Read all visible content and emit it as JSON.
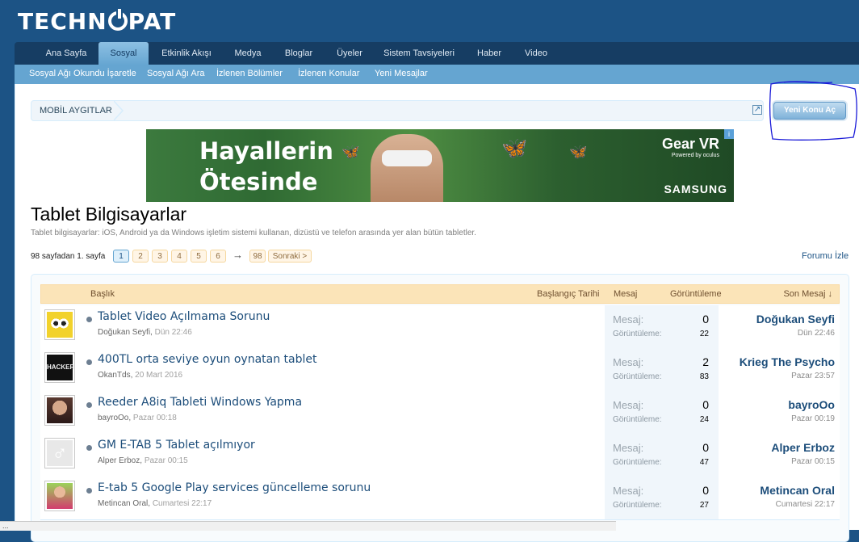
{
  "logo": {
    "text_pre": "TECHN",
    "text_post": "PAT"
  },
  "nav": {
    "tabs": [
      "Ana Sayfa",
      "Sosyal",
      "Etkinlik Akışı",
      "Medya",
      "Bloglar",
      "Üyeler",
      "Sistem Tavsiyeleri",
      "Haber",
      "Video"
    ],
    "active": "Sosyal"
  },
  "subnav": [
    "Sosyal Ağı Okundu İşaretle",
    "Sosyal Ağı Ara",
    "İzlenen Bölümler",
    "İzlenen Konular",
    "Yeni Mesajlar"
  ],
  "breadcrumb": "MOBİL AYGITLAR",
  "new_thread_button": "Yeni Konu Aç",
  "banner": {
    "headline_1": "Hayallerin",
    "headline_2": "Ötesinde",
    "brand": "Gear VR",
    "powered": "Powered by oculus",
    "maker": "SAMSUNG",
    "info": "i"
  },
  "forum": {
    "title": "Tablet Bilgisayarlar",
    "description": "Tablet bilgisayarlar: iOS, Android ya da Windows işletim sistemi kullanan, dizüstü ve telefon arasında yer alan bütün tabletler.",
    "follow": "Forumu İzle"
  },
  "pager": {
    "label": "98 sayfadan 1. sayfa",
    "pages": [
      "1",
      "2",
      "3",
      "4",
      "5",
      "6"
    ],
    "arrow": "→",
    "last": "98",
    "next": "Sonraki >"
  },
  "columns": {
    "title": "Başlık",
    "start_date": "Başlangıç Tarihi",
    "replies": "Mesaj",
    "views": "Görüntüleme",
    "last": "Son Mesaj ↓"
  },
  "threads": [
    {
      "title": "Tablet Video Açılmama Sorunu",
      "author": "Doğukan Seyfi",
      "date": "Dün 22:46",
      "replies_label": "Mesaj:",
      "replies": "0",
      "views_label": "Görüntüleme:",
      "views": "22",
      "last_user": "Doğukan Seyfi",
      "last_date": "Dün 22:46"
    },
    {
      "title": "400TL orta seviye oyun oynatan tablet",
      "author": "OkanTds",
      "date": "20 Mart 2016",
      "replies_label": "Mesaj:",
      "replies": "2",
      "views_label": "Görüntüleme:",
      "views": "83",
      "last_user": "Krieg The Psycho",
      "last_date": "Pazar 23:57"
    },
    {
      "title": "Reeder A8iq Tableti Windows Yapma",
      "author": "bayroOo",
      "date": "Pazar 00:18",
      "replies_label": "Mesaj:",
      "replies": "0",
      "views_label": "Görüntüleme:",
      "views": "24",
      "last_user": "bayroOo",
      "last_date": "Pazar 00:19"
    },
    {
      "title": "GM E-TAB 5 Tablet açılmıyor",
      "author": "Alper Erboz",
      "date": "Pazar 00:15",
      "replies_label": "Mesaj:",
      "replies": "0",
      "views_label": "Görüntüleme:",
      "views": "47",
      "last_user": "Alper Erboz",
      "last_date": "Pazar 00:15"
    },
    {
      "title": "E-tab 5 Google Play services güncelleme sorunu",
      "author": "Metincan Oral",
      "date": "Cumartesi 22:17",
      "replies_label": "Mesaj:",
      "replies": "0",
      "views_label": "Görüntüleme:",
      "views": "27",
      "last_user": "Metincan Oral",
      "last_date": "Cumartesi 22:17"
    }
  ],
  "statusbar": "...",
  "colors": {
    "header": "#1c5385",
    "nav": "#163d63",
    "subnav": "#65a5d1",
    "annotation": "#1a1ad8"
  }
}
